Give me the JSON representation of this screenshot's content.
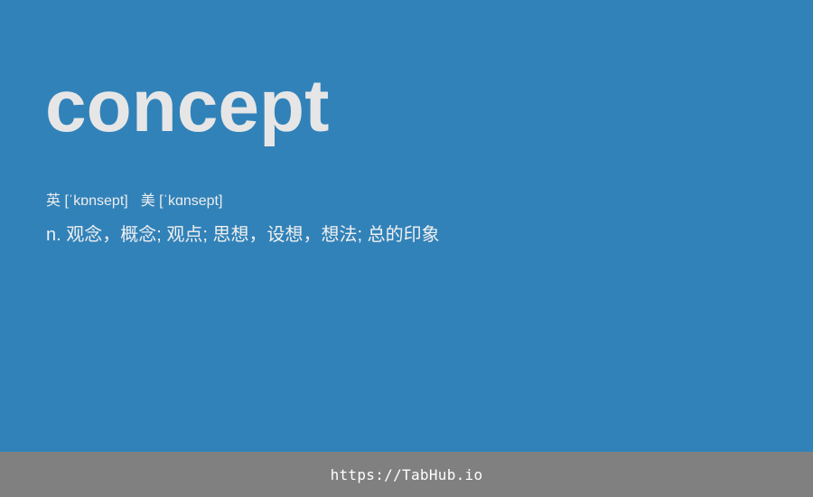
{
  "entry": {
    "word": "concept",
    "phonetics": {
      "uk": "英 [ˈkɒnsept]",
      "us": "美 [ˈkɑnsept]"
    },
    "definition": "n. 观念，概念; 观点; 思想，设想，想法; 总的印象"
  },
  "footer": {
    "link_text": "https://TabHub.io"
  },
  "colors": {
    "background": "#3182b9",
    "footer": "#808080",
    "word": "#e6e6e6"
  }
}
